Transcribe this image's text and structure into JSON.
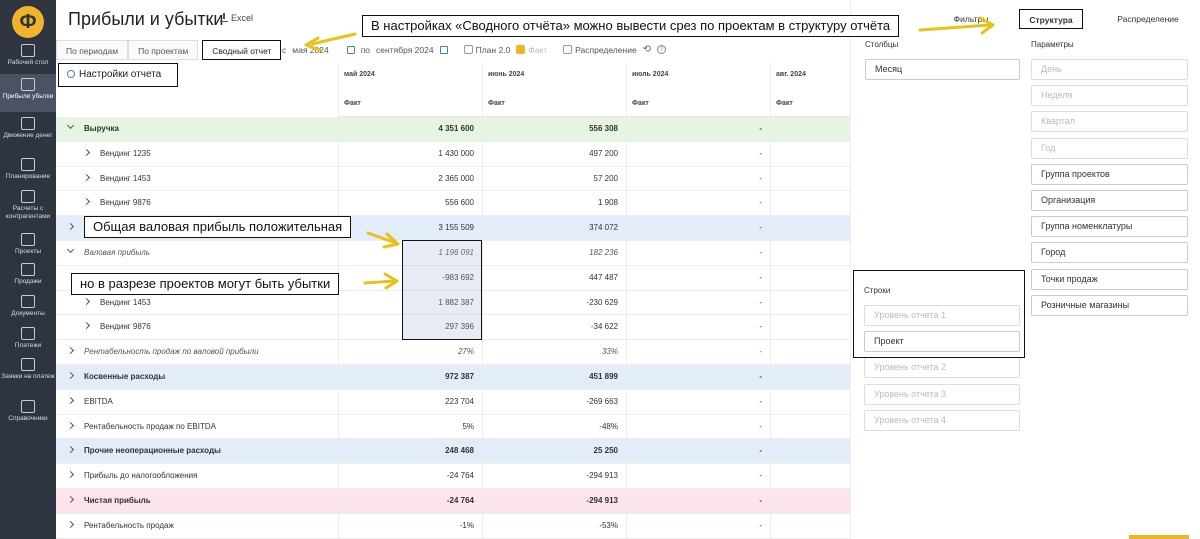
{
  "app": {
    "logo": "Ф",
    "title": "Прибыли и убытки",
    "excel_label": "Excel"
  },
  "sidebar": {
    "items": [
      {
        "label": "Рабочий стол",
        "icon": "desktop-icon"
      },
      {
        "label": "Прибыли убытки",
        "icon": "chart-icon",
        "active": true
      },
      {
        "label": "Движение денег",
        "icon": "money-flow-icon"
      },
      {
        "label": "Планирование",
        "icon": "planning-icon"
      },
      {
        "label": "Расчеты с контрагентами",
        "icon": "contractors-icon"
      },
      {
        "label": "Проекты",
        "icon": "projects-icon"
      },
      {
        "label": "Продажи",
        "icon": "sales-icon"
      },
      {
        "label": "Документы",
        "icon": "documents-icon"
      },
      {
        "label": "Платежи",
        "icon": "payments-icon"
      },
      {
        "label": "Заявки на платеж",
        "icon": "requests-icon"
      },
      {
        "label": "Справочники",
        "icon": "folder-icon"
      }
    ]
  },
  "tabs": [
    "По периодам",
    "По проектам",
    "Сводный отчет"
  ],
  "filters": {
    "from_prefix": "с",
    "from_value": "мая 2024",
    "to_prefix": "по",
    "to_value": "сентября 2024",
    "plan_label": "План 2.0",
    "fact_label": "Факт",
    "distribution_label": "Распределение"
  },
  "settings_button": "Настройки отчета",
  "columns": [
    {
      "month": "май 2024",
      "sub": "Факт"
    },
    {
      "month": "июнь 2024",
      "sub": "Факт"
    },
    {
      "month": "июль 2024",
      "sub": "Факт"
    },
    {
      "month": "авг. 2024",
      "sub": "Факт"
    }
  ],
  "rows": [
    {
      "label": "Выручка",
      "values": [
        "4 351 600",
        "556 308",
        "-",
        ""
      ]
    },
    {
      "label": "Вендинг 1235",
      "values": [
        "1 430 000",
        "497 200",
        "-",
        ""
      ]
    },
    {
      "label": "Вендинг 1453",
      "values": [
        "2 365 000",
        "57 200",
        "-",
        ""
      ]
    },
    {
      "label": "Вендинг 9876",
      "values": [
        "556 600",
        "1 908",
        "-",
        ""
      ]
    },
    {
      "label": "",
      "values": [
        "3 155 509",
        "374 072",
        "-",
        ""
      ]
    },
    {
      "label": "Валовая прибыль",
      "values": [
        "1 196 091",
        "182 236",
        "-",
        ""
      ]
    },
    {
      "label": "",
      "values": [
        "-983 692",
        "447 487",
        "-",
        ""
      ]
    },
    {
      "label": "Вендинг 1453",
      "values": [
        "1 882 387",
        "-230 629",
        "-",
        ""
      ]
    },
    {
      "label": "Вендинг 9876",
      "values": [
        "297 396",
        "-34 622",
        "-",
        ""
      ]
    },
    {
      "label": "Рентабельность продаж по валовой прибыли",
      "values": [
        "27%",
        "33%",
        "-",
        ""
      ]
    },
    {
      "label": "Косвенные расходы",
      "values": [
        "972 387",
        "451 899",
        "-",
        ""
      ]
    },
    {
      "label": "EBITDA",
      "values": [
        "223 704",
        "-269 663",
        "-",
        ""
      ]
    },
    {
      "label": "Рентабельность продаж по EBITDA",
      "values": [
        "5%",
        "-48%",
        "-",
        ""
      ]
    },
    {
      "label": "Прочие неоперационные расходы",
      "values": [
        "248 468",
        "25 250",
        "-",
        ""
      ]
    },
    {
      "label": "Прибыль до налогообложения",
      "values": [
        "-24 764",
        "-294 913",
        "-",
        ""
      ]
    },
    {
      "label": "Чистая прибыль",
      "values": [
        "-24 764",
        "-294 913",
        "-",
        ""
      ]
    },
    {
      "label": "Рентабельность продаж",
      "values": [
        "-1%",
        "-53%",
        "-",
        ""
      ]
    }
  ],
  "right_panel": {
    "tabs": [
      "Фильтры",
      "Структура",
      "Распределение"
    ],
    "columns_label": "Столбцы",
    "columns_field": "Месяц",
    "params_label": "Параметры",
    "params": [
      "День",
      "Неделя",
      "Квартал",
      "Год",
      "Группа проектов",
      "Организация",
      "Группа номенклатуры",
      "Город",
      "Точки продаж",
      "Розничные магазины"
    ],
    "rows_label": "Строки",
    "rows_fields": [
      "Уровень отчета 1",
      "Проект",
      "Уровень отчета 2",
      "Уровень отчета 3",
      "Уровень отчета 4"
    ]
  },
  "callouts": {
    "top": "В настройках «Сводного отчёта» можно вывести срез по проектам в структуру отчёта",
    "gross": "Общая валовая прибыль положительная",
    "losses": "но в разрезе проектов могут быть убытки"
  },
  "colors": {
    "accent": "#f0b429",
    "sidebar": "#2e3440",
    "revenue_row": "#e6f4e1",
    "highlight_row": "#e3ecf9",
    "net_profit_row": "#fbe5ea"
  }
}
